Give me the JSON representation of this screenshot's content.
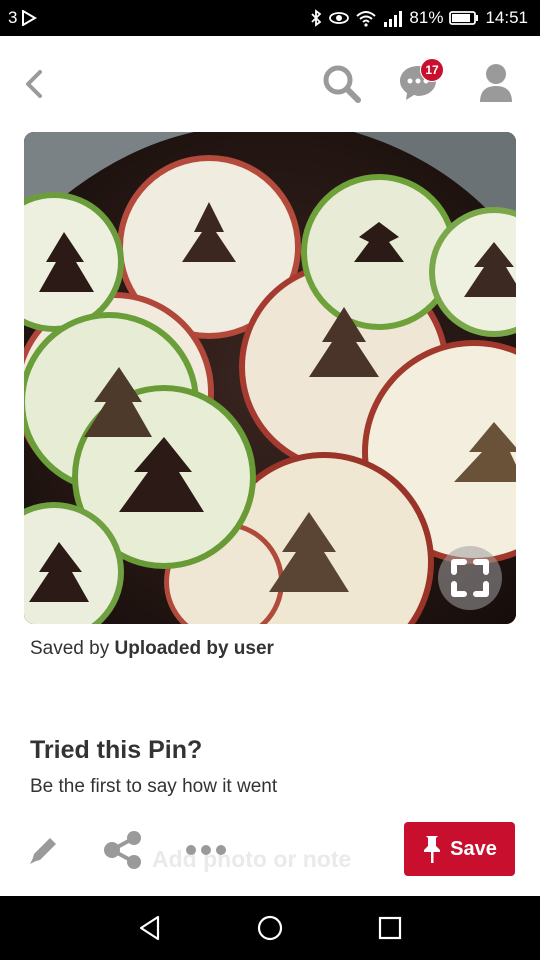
{
  "status_bar": {
    "notification_count": "3",
    "battery_percent": "81%",
    "time": "14:51"
  },
  "header": {
    "message_badge_count": "17"
  },
  "pin": {
    "saved_by_prefix": "Saved by",
    "saved_by_name": "Uploaded by user"
  },
  "tried": {
    "title": "Tried this Pin?",
    "subtitle": "Be the first to say how it went"
  },
  "action_bar": {
    "add_note_label": "Add photo or note",
    "save_label": "Save"
  },
  "colors": {
    "accent": "#c8102e",
    "icon_gray": "#9a9a9a"
  },
  "icons": [
    "back-arrow-icon",
    "search-icon",
    "messages-icon",
    "profile-icon",
    "expand-icon",
    "edit-icon",
    "share-icon",
    "more-icon",
    "pin-icon"
  ]
}
